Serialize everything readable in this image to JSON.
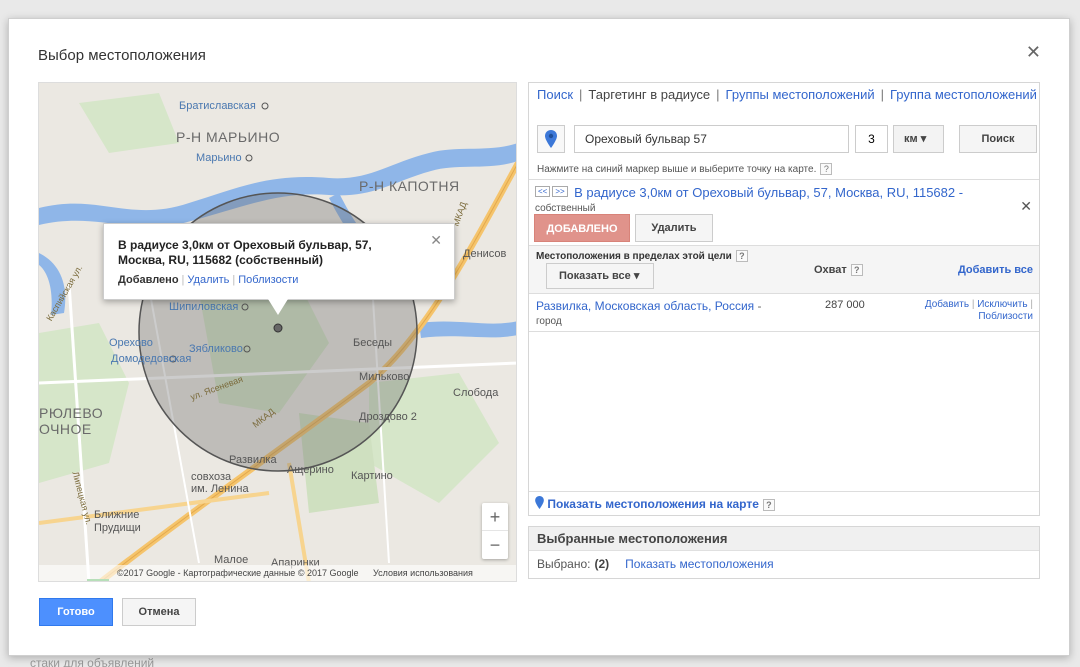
{
  "background": {
    "footer_text": "стаки для объявлений"
  },
  "dialog": {
    "title": "Выбор местоположения",
    "close_glyph": "✕"
  },
  "map": {
    "labels": {
      "bratislavskaya": "Братиславская",
      "marino_district": "Р-Н МАРЬИНО",
      "marino": "Марьино",
      "kapotnya": "Р-Н КАПОТНЯ",
      "denisovsky": "Денисов",
      "shipilovskaya": "Шипиловская",
      "orekhovo": "Орехово",
      "domodedovskaya": "Домодедовская",
      "zyablikovo": "Зябликово",
      "besedy": "Беседы",
      "milkovo": "Мильково",
      "slobodka": "Слобода",
      "drozdovo": "Дроздово 2",
      "biryulevo1": "РЮЛЕВО",
      "biryulevo2": "ОЧНОЕ",
      "razvilka": "Развилка",
      "shcherino": "Ащерино",
      "kartino": "Картино",
      "sovkhoz1": "совхоза",
      "sovkhoz2": "им. Ленина",
      "prudishchi1": "Ближние",
      "prudishchi2": "Прудищи",
      "maloe": "Малое",
      "aparinki": "Апаринки",
      "mkad": "МКАД",
      "mkad2": "МКАД",
      "yasenevaya": "ул. Ясеневая",
      "kaspiyskaya": "Каспийская ул.",
      "lipetskaya": "Липецкая ул."
    },
    "infowindow": {
      "title": "В радиусе 3,0км от Ореховый бульвар, 57, Москва, RU, 115682 (собственный)",
      "status": "Добавлено",
      "remove": "Удалить",
      "nearby": "Поблизости",
      "close": "✕"
    },
    "zoom": {
      "in": "+",
      "out": "−"
    },
    "footer": {
      "copyright": "©2017 Google - Картографические данные © 2017 Google",
      "terms": "Условия использования"
    }
  },
  "tabs": {
    "search": "Поиск",
    "radius": "Таргетинг в радиусе",
    "groups": "Группы местоположений",
    "group": "Группа местоположений"
  },
  "search": {
    "address_value": "Ореховый бульвар 57",
    "radius_value": "3",
    "unit": "км",
    "button": "Поиск",
    "hint": "Нажмите на синий маркер выше и выберите точку на карте.",
    "help": "?"
  },
  "target": {
    "prev": "<<",
    "next": ">>",
    "title": "В радиусе 3,0км от Ореховый бульвар, 57, Москва, RU, 115682 -",
    "subtitle": "собственный",
    "added_button": "ДОБАВЛЕНО",
    "remove_button": "Удалить",
    "close": "✕"
  },
  "within": {
    "title": "Местоположения в пределах этой цели",
    "show_all": "Показать все",
    "reach_header": "Охват",
    "add_all": "Добавить все",
    "rows": [
      {
        "name": "Развилка, Московская область, Россия",
        "dash": "-",
        "type": "город",
        "reach": "287 000",
        "add": "Добавить",
        "exclude": "Исключить",
        "nearby": "Поблизости"
      }
    ]
  },
  "show_on_map": "Показать местоположения на карте",
  "selected": {
    "title": "Выбранные местоположения",
    "label": "Выбрано:",
    "count": "(2)",
    "show_link": "Показать местоположения"
  },
  "footer_buttons": {
    "ok": "Готово",
    "cancel": "Отмена"
  },
  "colors": {
    "accent": "#3366cc",
    "primary_button": "#4d90fe",
    "added_button": "#e0938b",
    "water": "#8fb6e8",
    "park": "#cfe3c4",
    "road": "#f5c46c"
  }
}
